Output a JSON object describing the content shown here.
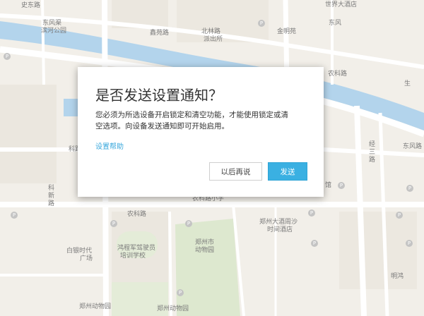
{
  "dialog": {
    "title": "是否发送设置通知？",
    "body": "您必须为所选设备开启锁定和清空功能，才能使用锁定或清空选项。向设备发送通知即可开始启用。",
    "help_link": "设置帮助",
    "later_button": "以后再说",
    "send_button": "发送"
  },
  "map": {
    "labels": {
      "road_1": "史东路",
      "park_1": "东风渠",
      "park_2": "滨河公园",
      "road_2": "鑫苑路",
      "road_3": "北林路",
      "poi_1": "派出所",
      "poi_2": "金明苑",
      "road_4": "世界大酒店",
      "road_5": "东风路",
      "road_6": "农科路",
      "road_7": "科路",
      "road_8": "科新路",
      "road_9": "经三路",
      "road_10": "东风路",
      "poi_3": "农科路小学",
      "poi_4": "郑州大酒周沙",
      "poi_5": "时间酒店",
      "poi_6": "郑州市",
      "poi_7": "动物园",
      "poi_8": "鸿程军驾驶员",
      "poi_9": "培训学校",
      "poi_10": "白银时代",
      "poi_11": "广场",
      "poi_12": "郑州动物园",
      "poi_13": "郑州动物园",
      "poi_14": "明鸿",
      "poi_15": "生",
      "poi_16": "东风",
      "poi_17": "馆"
    },
    "colors": {
      "background": "#f2efe9",
      "water": "#b3d4ec",
      "road": "#ffffff",
      "green": "#dde8cf"
    }
  }
}
